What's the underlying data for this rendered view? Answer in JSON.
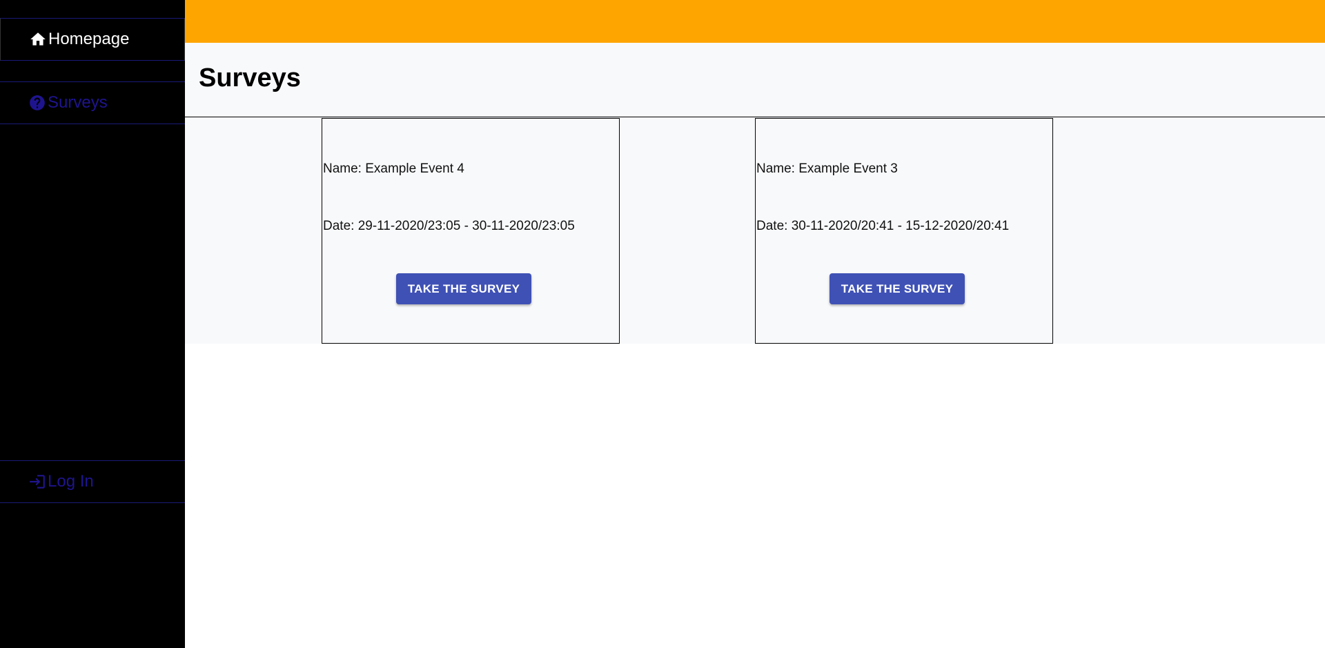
{
  "sidebar": {
    "items": [
      {
        "label": "Homepage",
        "icon": "home-icon"
      },
      {
        "label": "Surveys",
        "icon": "help-circle-icon"
      },
      {
        "label": "Log In",
        "icon": "login-icon"
      }
    ]
  },
  "colors": {
    "topbar": "#ffa500",
    "sidebar": "#000000",
    "nav_link": "#1f148f",
    "button": "#3f51b5"
  },
  "page": {
    "title": "Surveys"
  },
  "cards": [
    {
      "name": "Name: Example Event 4",
      "date": "Date: 29-11-2020/23:05 - 30-11-2020/23:05",
      "button": "TAKE THE SURVEY"
    },
    {
      "name": "Name: Example Event 3",
      "date": "Date: 30-11-2020/20:41 - 15-12-2020/20:41",
      "button": "TAKE THE SURVEY"
    }
  ]
}
